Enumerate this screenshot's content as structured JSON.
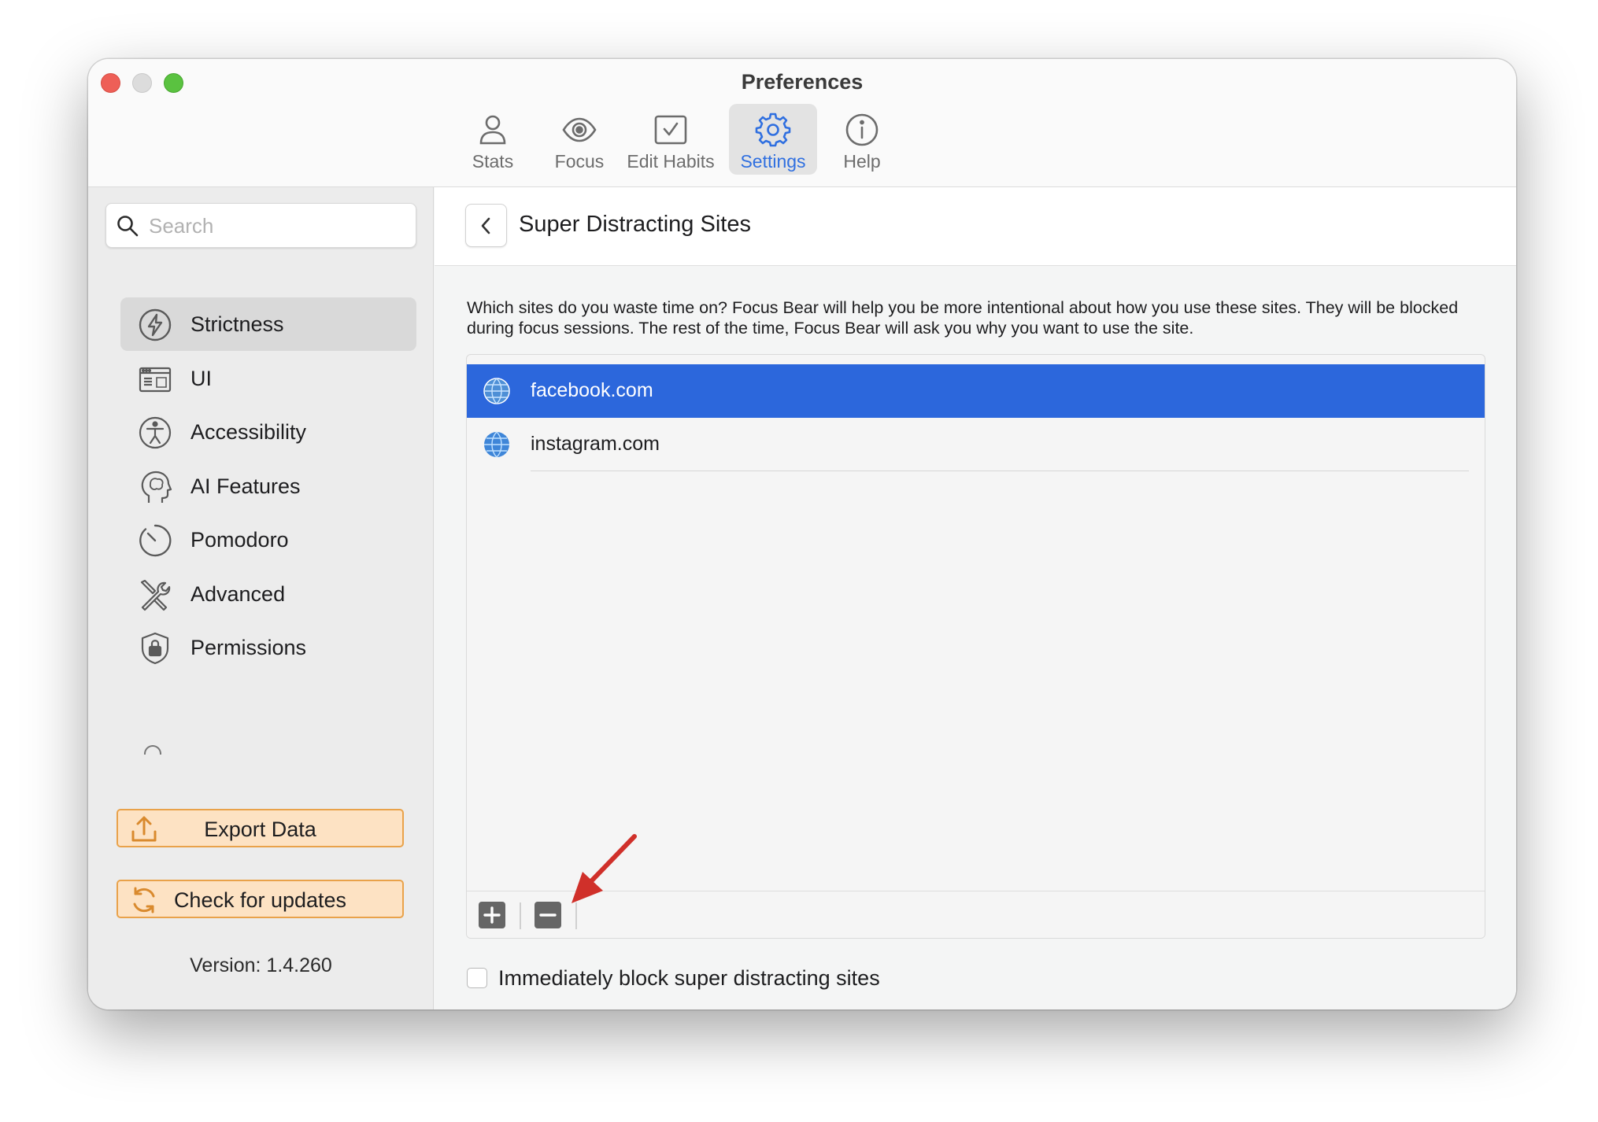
{
  "window": {
    "title": "Preferences"
  },
  "toolbar": {
    "tabs": [
      {
        "label": "Stats",
        "icon": "person-icon"
      },
      {
        "label": "Focus",
        "icon": "eye-icon"
      },
      {
        "label": "Edit Habits",
        "icon": "checkbox-icon"
      },
      {
        "label": "Settings",
        "icon": "gear-icon",
        "active": true
      },
      {
        "label": "Help",
        "icon": "info-icon"
      }
    ]
  },
  "sidebar": {
    "search": {
      "placeholder": "Search",
      "value": ""
    },
    "items": [
      {
        "label": "Strictness",
        "icon": "lightning-icon",
        "active": true
      },
      {
        "label": "UI",
        "icon": "window-icon"
      },
      {
        "label": "Accessibility",
        "icon": "accessibility-icon"
      },
      {
        "label": "AI Features",
        "icon": "brain-head-icon"
      },
      {
        "label": "Pomodoro",
        "icon": "timer-icon"
      },
      {
        "label": "Advanced",
        "icon": "tools-icon"
      },
      {
        "label": "Permissions",
        "icon": "shield-lock-icon"
      }
    ],
    "export_label": "Export Data",
    "updates_label": "Check for updates",
    "version": "Version: 1.4.260"
  },
  "main": {
    "title": "Super Distracting Sites",
    "description": "Which sites do you waste time on? Focus Bear will help you be more intentional about how you use these sites. They will be blocked during focus sessions. The rest of the time, Focus Bear will ask you why you want to use the site.",
    "sites": [
      {
        "domain": "facebook.com",
        "selected": true
      },
      {
        "domain": "instagram.com",
        "selected": false
      }
    ],
    "immediate_block_label": "Immediately block super distracting sites",
    "immediate_block_checked": false
  },
  "colors": {
    "accent": "#2c67dc",
    "button_fill": "#fde2c3",
    "button_border": "#e9a24a",
    "annotation_arrow": "#d0302a"
  }
}
